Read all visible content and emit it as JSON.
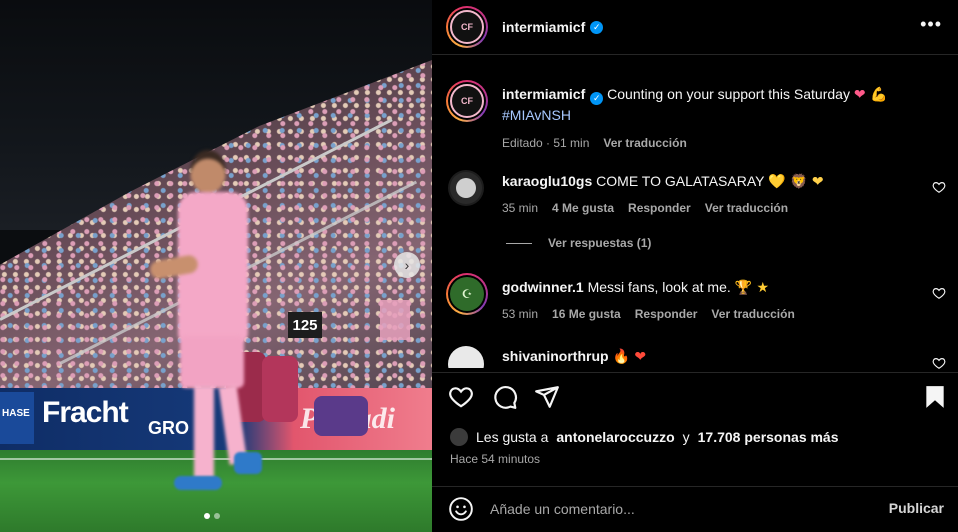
{
  "post": {
    "account": "intermiamicf",
    "crest_text": "CF",
    "media": {
      "stand_sign": "125",
      "board_left": "HASE",
      "board_brand": "Fracht",
      "board_suffix": "GRO",
      "board_right": "Palkadi",
      "slide_index": 1,
      "slide_count": 2
    },
    "caption": {
      "username": "intermiamicf",
      "text": "Counting on your support this Saturday",
      "emojis": "❤ 💪",
      "hashtag": "#MIAvNSH",
      "edited": "Editado",
      "time": "51 min",
      "translate": "Ver traducción"
    }
  },
  "comments": [
    {
      "username": "karaoglu10gs",
      "text": "COME TO GALATASARAY",
      "emojis": "💛 🦁 ❤",
      "time": "35 min",
      "likes": "4 Me gusta",
      "reply": "Responder",
      "translate": "Ver traducción",
      "view_replies": "Ver respuestas (1)"
    },
    {
      "username": "godwinner.1",
      "text": "Messi fans, look at me.",
      "emojis": "🏆 ★",
      "time": "53 min",
      "likes": "16 Me gusta",
      "reply": "Responder",
      "translate": "Ver traducción"
    },
    {
      "username": "shivaninorthrup",
      "text": "",
      "emojis": "🔥 ❤"
    }
  ],
  "likes_line": {
    "prefix": "Les gusta a",
    "user": "antonelaroccuzzo",
    "connector": "y",
    "others": "17.708 personas más"
  },
  "timestamp": "Hace 54 minutos",
  "comment_box": {
    "placeholder": "Añade un comentario...",
    "publish": "Publicar"
  },
  "icons": {
    "more": "more-horizontal-icon",
    "like": "heart-outline-icon",
    "comment": "comment-icon",
    "share": "send-icon",
    "save": "bookmark-filled-icon",
    "emoji": "emoji-smile-icon",
    "next": "chevron-right-icon",
    "verified": "verified-badge-icon"
  },
  "colors": {
    "background": "#000000",
    "text": "#f5f5f5",
    "muted": "#a8a8a8",
    "verified": "#0095f6",
    "hashtag": "#a7c8ff"
  }
}
